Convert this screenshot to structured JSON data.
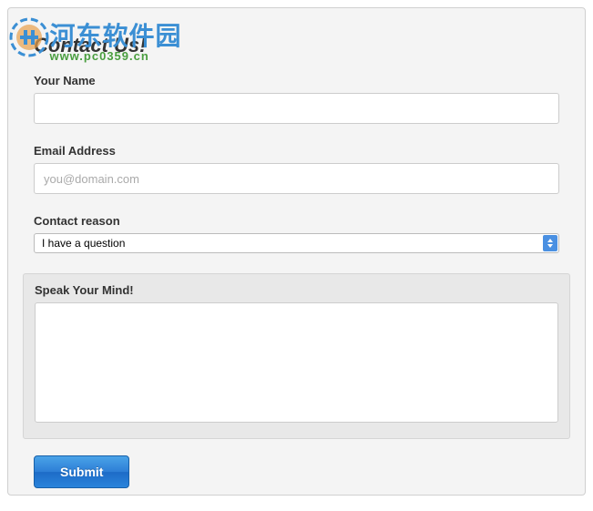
{
  "watermark": {
    "cn_text": "河东软件园",
    "url_text": "www.pc0359.cn"
  },
  "form": {
    "title": "Contact Us!",
    "name": {
      "label": "Your Name",
      "value": ""
    },
    "email": {
      "label": "Email Address",
      "placeholder": "you@domain.com",
      "value": ""
    },
    "reason": {
      "label": "Contact reason",
      "selected": "I have a question"
    },
    "message": {
      "label": "Speak Your Mind!",
      "value": ""
    },
    "submit_label": "Submit"
  }
}
